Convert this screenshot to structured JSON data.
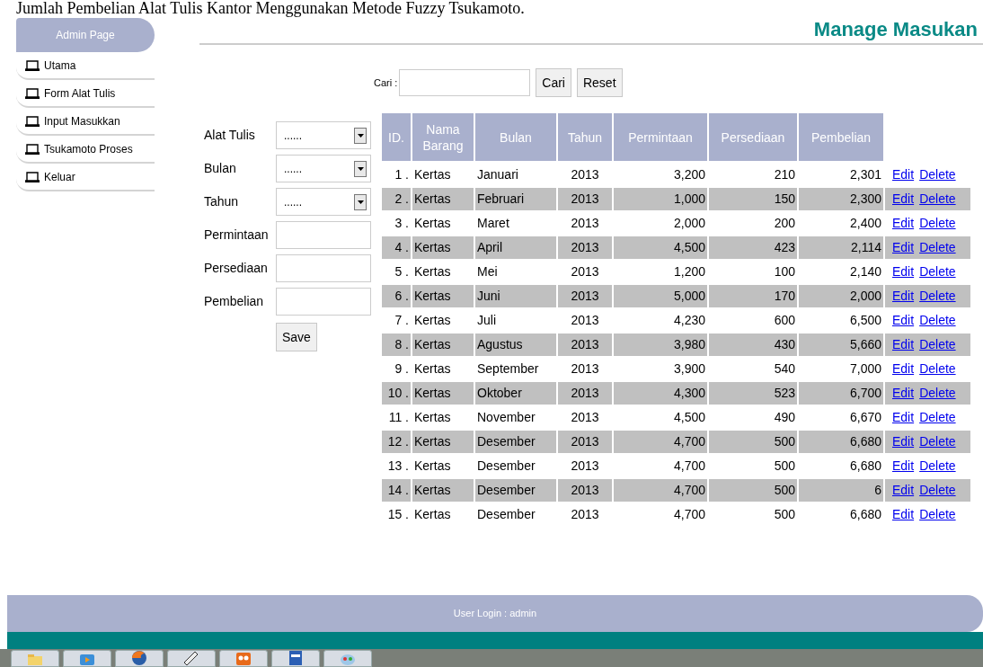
{
  "document_caption": "Jumlah Pembelian Alat Tulis Kantor Menggunakan Metode Fuzzy Tsukamoto.",
  "sidebar": {
    "title": "Admin Page",
    "items": [
      {
        "label": "Utama"
      },
      {
        "label": "Form Alat Tulis"
      },
      {
        "label": "Input Masukkan"
      },
      {
        "label": "Tsukamoto Proses"
      },
      {
        "label": "Keluar"
      }
    ]
  },
  "page_title": "Manage Masukan",
  "search": {
    "label": "Cari :",
    "buttons": [
      "Cari",
      "Reset"
    ]
  },
  "form": {
    "fields": [
      {
        "kind": "select",
        "label": "Alat Tulis",
        "value": "......"
      },
      {
        "kind": "select",
        "label": "Bulan",
        "value": "......"
      },
      {
        "kind": "select",
        "label": "Tahun",
        "value": "......"
      },
      {
        "kind": "text",
        "label": "Permintaan"
      },
      {
        "kind": "text",
        "label": "Persediaan"
      },
      {
        "kind": "text",
        "label": "Pembelian"
      }
    ],
    "button": "Save"
  },
  "table": {
    "columns": [
      "ID.",
      "Nama Barang",
      "Bulan",
      "Tahun",
      "Permintaan",
      "Persediaan",
      "Pembelian"
    ],
    "rows": [
      {
        "id": "1 .",
        "nama": "Kertas",
        "bulan": "Januari",
        "tahun": "2013",
        "permintaan": "3,200",
        "persediaan": "210",
        "pembelian": "2,301",
        "actions": [
          "Edit",
          "Delete"
        ]
      },
      {
        "id": "2 .",
        "nama": "Kertas",
        "bulan": "Februari",
        "tahun": "2013",
        "permintaan": "1,000",
        "persediaan": "150",
        "pembelian": "2,300",
        "actions": [
          "Edit",
          "Delete"
        ]
      },
      {
        "id": "3 .",
        "nama": "Kertas",
        "bulan": "Maret",
        "tahun": "2013",
        "permintaan": "2,000",
        "persediaan": "200",
        "pembelian": "2,400",
        "actions": [
          "Edit",
          "Delete"
        ]
      },
      {
        "id": "4 .",
        "nama": "Kertas",
        "bulan": "April",
        "tahun": "2013",
        "permintaan": "4,500",
        "persediaan": "423",
        "pembelian": "2,114",
        "actions": [
          "Edit",
          "Delete"
        ]
      },
      {
        "id": "5 .",
        "nama": "Kertas",
        "bulan": "Mei",
        "tahun": "2013",
        "permintaan": "1,200",
        "persediaan": "100",
        "pembelian": "2,140",
        "actions": [
          "Edit",
          "Delete"
        ]
      },
      {
        "id": "6 .",
        "nama": "Kertas",
        "bulan": "Juni",
        "tahun": "2013",
        "permintaan": "5,000",
        "persediaan": "170",
        "pembelian": "2,000",
        "actions": [
          "Edit",
          "Delete"
        ]
      },
      {
        "id": "7 .",
        "nama": "Kertas",
        "bulan": "Juli",
        "tahun": "2013",
        "permintaan": "4,230",
        "persediaan": "600",
        "pembelian": "6,500",
        "actions": [
          "Edit",
          "Delete"
        ]
      },
      {
        "id": "8 .",
        "nama": "Kertas",
        "bulan": "Agustus",
        "tahun": "2013",
        "permintaan": "3,980",
        "persediaan": "430",
        "pembelian": "5,660",
        "actions": [
          "Edit",
          "Delete"
        ]
      },
      {
        "id": "9 .",
        "nama": "Kertas",
        "bulan": "September",
        "tahun": "2013",
        "permintaan": "3,900",
        "persediaan": "540",
        "pembelian": "7,000",
        "actions": [
          "Edit",
          "Delete"
        ]
      },
      {
        "id": "10 .",
        "nama": "Kertas",
        "bulan": "Oktober",
        "tahun": "2013",
        "permintaan": "4,300",
        "persediaan": "523",
        "pembelian": "6,700",
        "actions": [
          "Edit",
          "Delete"
        ]
      },
      {
        "id": "11 .",
        "nama": "Kertas",
        "bulan": "November",
        "tahun": "2013",
        "permintaan": "4,500",
        "persediaan": "490",
        "pembelian": "6,670",
        "actions": [
          "Edit",
          "Delete"
        ]
      },
      {
        "id": "12 .",
        "nama": "Kertas",
        "bulan": "Desember",
        "tahun": "2013",
        "permintaan": "4,700",
        "persediaan": "500",
        "pembelian": "6,680",
        "actions": [
          "Edit",
          "Delete"
        ]
      },
      {
        "id": "13 .",
        "nama": "Kertas",
        "bulan": "Desember",
        "tahun": "2013",
        "permintaan": "4,700",
        "persediaan": "500",
        "pembelian": "6,680",
        "actions": [
          "Edit",
          "Delete"
        ]
      },
      {
        "id": "14 .",
        "nama": "Kertas",
        "bulan": "Desember",
        "tahun": "2013",
        "permintaan": "4,700",
        "persediaan": "500",
        "pembelian": "6",
        "actions": [
          "Edit",
          "Delete"
        ]
      },
      {
        "id": "15 .",
        "nama": "Kertas",
        "bulan": "Desember",
        "tahun": "2013",
        "permintaan": "4,700",
        "persediaan": "500",
        "pembelian": "6,680",
        "actions": [
          "Edit",
          "Delete"
        ]
      }
    ]
  },
  "footer": {
    "text": "User Login : admin"
  },
  "taskbar": {
    "apps": [
      {
        "kind": "folder"
      },
      {
        "kind": "media"
      },
      {
        "kind": "browser"
      },
      {
        "kind": "pen"
      },
      {
        "kind": "orange"
      },
      {
        "kind": "word"
      },
      {
        "kind": "paint"
      }
    ]
  }
}
